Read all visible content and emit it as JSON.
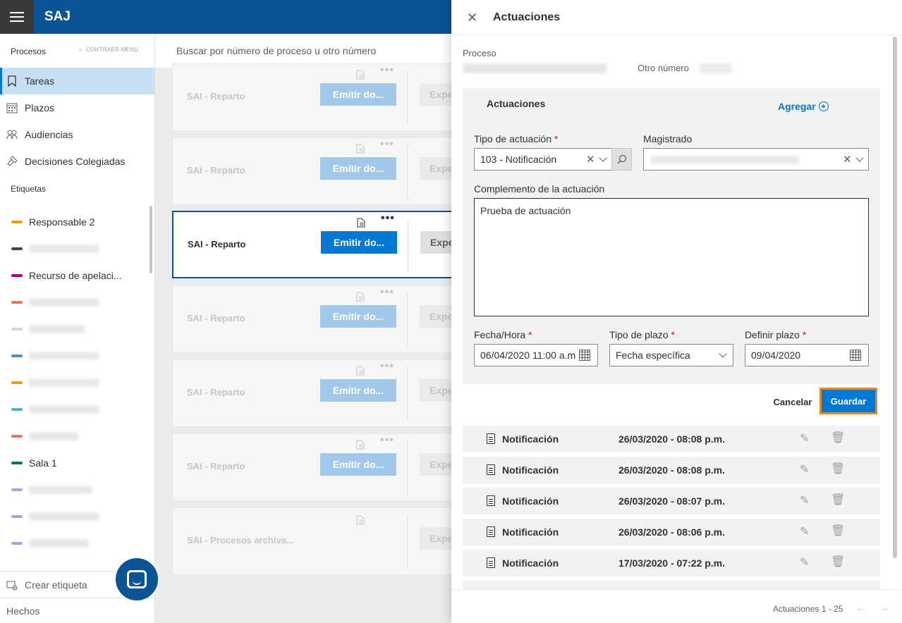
{
  "app": {
    "title": "SAJ"
  },
  "sidebar": {
    "procesos_label": "Procesos",
    "collapse_label": "CONTRAER MENÚ",
    "items": [
      {
        "label": "Tareas",
        "icon": "bookmark-icon",
        "active": true
      },
      {
        "label": "Plazos",
        "icon": "calendar-icon"
      },
      {
        "label": "Audiencias",
        "icon": "people-icon"
      },
      {
        "label": "Decisiones Colegiadas",
        "icon": "gavel-icon"
      }
    ],
    "tags_header": "Etiquetas",
    "tags": [
      {
        "label": "Responsable 2",
        "color": "#e8a200"
      },
      {
        "label": "",
        "color": "#3b4a5a"
      },
      {
        "label": "Recurso de apelaci...",
        "color": "#a0007a"
      },
      {
        "label": "",
        "color": "#e07a5f"
      },
      {
        "label": "",
        "color": "#d6d6d6"
      },
      {
        "label": "",
        "color": "#4a90c8"
      },
      {
        "label": "",
        "color": "#e8a200"
      },
      {
        "label": "",
        "color": "#4ab8c8"
      },
      {
        "label": "",
        "color": "#e07a5f"
      },
      {
        "label": "Sala 1",
        "color": "#007a5a"
      },
      {
        "label": "",
        "color": "#b0a0e8"
      },
      {
        "label": "",
        "color": "#b0a0e8"
      },
      {
        "label": "",
        "color": "#b0a0e8"
      }
    ],
    "create_tag": "Crear etiqueta",
    "footer": "Hechos"
  },
  "search": {
    "placeholder": "Buscar por número de proceso u otro número"
  },
  "cards": [
    {
      "title": "SAI - Reparto",
      "button": "Emitir do...",
      "button2": "Expe"
    },
    {
      "title": "SAI - Reparto",
      "button": "Emitir do...",
      "button2": "Expe"
    },
    {
      "title": "SAI - Reparto",
      "button": "Emitir do...",
      "button2": "Expe",
      "active": true
    },
    {
      "title": "SAI - Reparto",
      "button": "Emitir do...",
      "button2": "Expe"
    },
    {
      "title": "SAI - Reparto",
      "button": "Emitir do...",
      "button2": "Expe"
    },
    {
      "title": "SAI - Reparto",
      "button": "Emitir do...",
      "button2": "Expe"
    },
    {
      "title": "SAI - Procesos archiva...",
      "button": "",
      "button2": "Expe"
    }
  ],
  "panel": {
    "title": "Actuaciones",
    "proceso_label": "Proceso",
    "otro_label": "Otro número",
    "section_title": "Actuaciones",
    "add_label": "Agregar",
    "tipo_label": "Tipo de actuación",
    "tipo_value": "103 - Notificación",
    "magistrado_label": "Magistrado",
    "complemento_label": "Complemento de la actuación",
    "complemento_value": "Prueba de actuación",
    "fecha_label": "Fecha/Hora",
    "fecha_value": "06/04/2020 11:00 a.m",
    "tipo_plazo_label": "Tipo de plazo",
    "tipo_plazo_value": "Fecha específica",
    "definir_label": "Definir plazo",
    "definir_value": "09/04/2020",
    "cancel": "Cancelar",
    "save": "Guardar",
    "rows": [
      {
        "label": "Notificación",
        "date": "26/03/2020 - 08:08 p.m."
      },
      {
        "label": "Notificación",
        "date": "26/03/2020 - 08:08 p.m."
      },
      {
        "label": "Notificación",
        "date": "26/03/2020 - 08:07 p.m."
      },
      {
        "label": "Notificación",
        "date": "26/03/2020 - 08:06 p.m."
      },
      {
        "label": "Notificación",
        "date": "17/03/2020 - 07:22 p.m."
      }
    ],
    "pager": "Actuaciones 1 - 25"
  }
}
